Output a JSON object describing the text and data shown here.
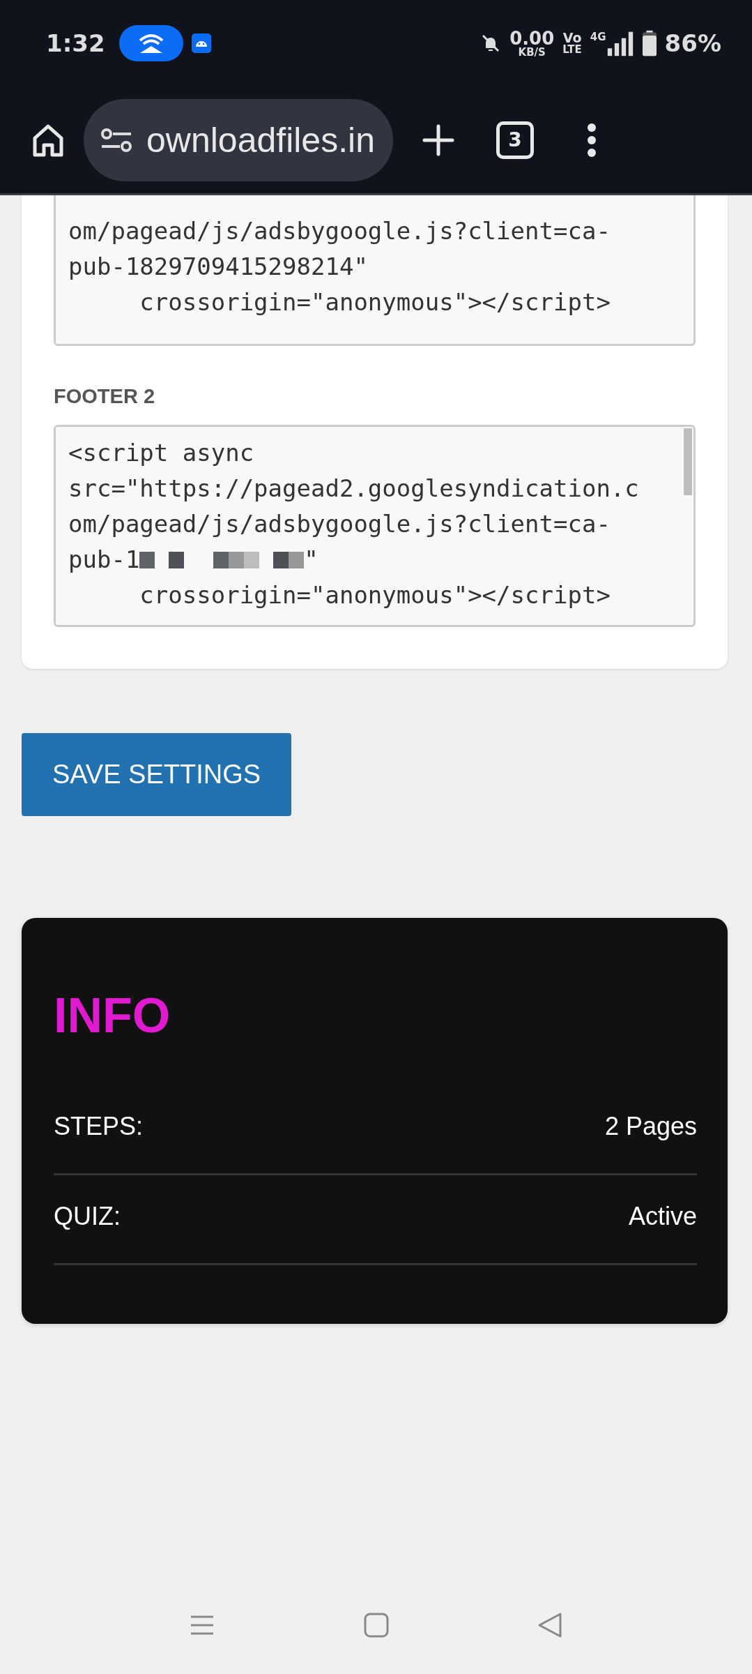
{
  "status_bar": {
    "time": "1:32",
    "net_speed": "0.00",
    "net_unit": "KB/S",
    "volte_top": "Vo",
    "volte_bottom": "LTE",
    "network": "4G",
    "battery": "86%"
  },
  "browser": {
    "url": "ownloadfiles.in",
    "tab_count": "3"
  },
  "fields": [
    {
      "lines": [
        {
          "text": "om/pagead/js/adsbygoogle.js?client=ca-",
          "redacted": false
        },
        {
          "text": "pub-1829709415298214\"",
          "redacted": false
        },
        {
          "text": "     crossorigin=\"anonymous\"></script>",
          "redacted": false
        }
      ],
      "scrolled": true
    },
    {
      "label": "FOOTER 2",
      "lines": [
        {
          "text": "<script async",
          "redacted": false
        },
        {
          "text": "src=\"https://pagead2.googlesyndication.c",
          "redacted": false
        },
        {
          "text": "om/pagead/js/adsbygoogle.js?client=ca-",
          "redacted": false
        },
        {
          "text": "pub-1",
          "redacted": true,
          "tail": "\""
        },
        {
          "text": "     crossorigin=\"anonymous\"></script>",
          "redacted": false
        }
      ],
      "scrolled": false
    }
  ],
  "save_button": "SAVE SETTINGS",
  "info": {
    "title": "INFO",
    "rows": [
      {
        "label": "STEPS:",
        "value": "2 Pages"
      },
      {
        "label": "QUIZ:",
        "value": "Active"
      }
    ]
  }
}
